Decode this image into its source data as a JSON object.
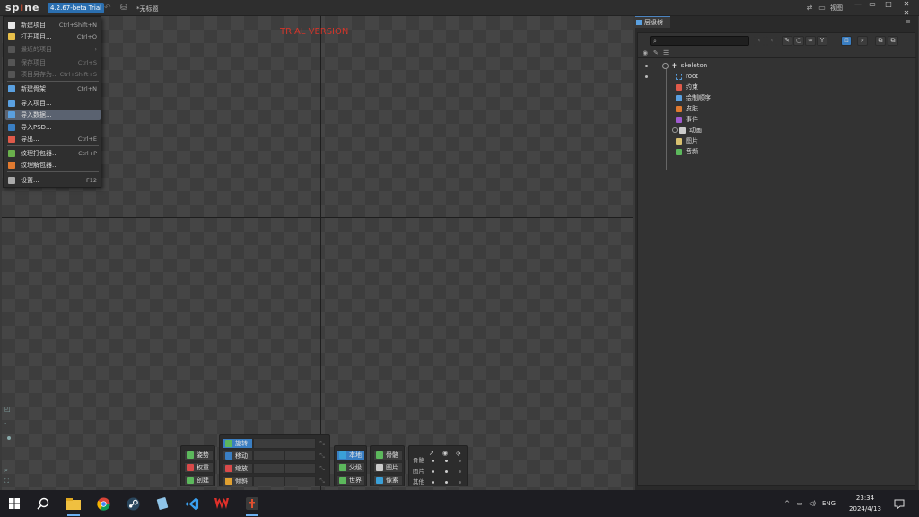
{
  "titlebar": {
    "logo_prefix": "sp",
    "logo_accent": "i",
    "logo_suffix": "ne",
    "version": "4.2.67-beta Trial",
    "document_title": "*无标题",
    "view_label": "视图"
  },
  "viewport": {
    "watermark": "TRIAL VERSION"
  },
  "menu": {
    "items": [
      {
        "label": "新建项目",
        "shortcut": "Ctrl+Shift+N",
        "icon_color": "#e8e8e8",
        "disabled": false
      },
      {
        "label": "打开项目...",
        "shortcut": "Ctrl+O",
        "icon_color": "#e8c04a",
        "disabled": false
      },
      {
        "label": "最近的项目",
        "shortcut": "›",
        "icon_color": "#555555",
        "disabled": true
      },
      {
        "label": "保存项目",
        "shortcut": "Ctrl+S",
        "icon_color": "#555555",
        "disabled": true
      },
      {
        "label": "项目另存为...",
        "shortcut": "Ctrl+Shift+S",
        "icon_color": "#555555",
        "disabled": true
      },
      {
        "label": "新建骨架",
        "shortcut": "Ctrl+N",
        "icon_color": "#5aa0e0",
        "disabled": false
      },
      {
        "label": "导入项目...",
        "shortcut": "",
        "icon_color": "#5aa0e0",
        "disabled": false
      },
      {
        "label": "导入数据...",
        "shortcut": "",
        "icon_color": "#5aa0e0",
        "disabled": false
      },
      {
        "label": "导入PSD...",
        "shortcut": "",
        "icon_color": "#3a7ec2",
        "disabled": false
      },
      {
        "label": "导出...",
        "shortcut": "Ctrl+E",
        "icon_color": "#e05a4a",
        "disabled": false
      },
      {
        "label": "纹理打包器...",
        "shortcut": "Ctrl+P",
        "icon_color": "#6ab04c",
        "disabled": false
      },
      {
        "label": "纹理解包器...",
        "shortcut": "",
        "icon_color": "#e07a30",
        "disabled": false
      },
      {
        "label": "设置...",
        "shortcut": "F12",
        "icon_color": "#aaaaaa",
        "disabled": false
      }
    ],
    "active_index": 7
  },
  "toolbar": {
    "pose": "姿势",
    "weights": "权重",
    "create": "创建",
    "rotate": "旋转",
    "translate": "移动",
    "scale": "缩放",
    "shear": "倾斜",
    "local": "本地",
    "parent": "父级",
    "world": "世界",
    "bones": "骨骼",
    "images": "图片",
    "pixels": "像素",
    "opt_bones": "骨骼",
    "opt_images": "图片",
    "opt_others": "其他"
  },
  "panel": {
    "tab_title": "层级树",
    "search_placeholder": "",
    "tree": {
      "skeleton": "skeleton",
      "root": "root",
      "constraints": "约束",
      "draw_order": "绘制顺序",
      "skins": "皮肤",
      "events": "事件",
      "animations": "动画",
      "images": "图片",
      "audio": "音频"
    }
  },
  "taskbar": {
    "lang": "ENG",
    "time": "23:34",
    "date": "2024/4/13"
  }
}
